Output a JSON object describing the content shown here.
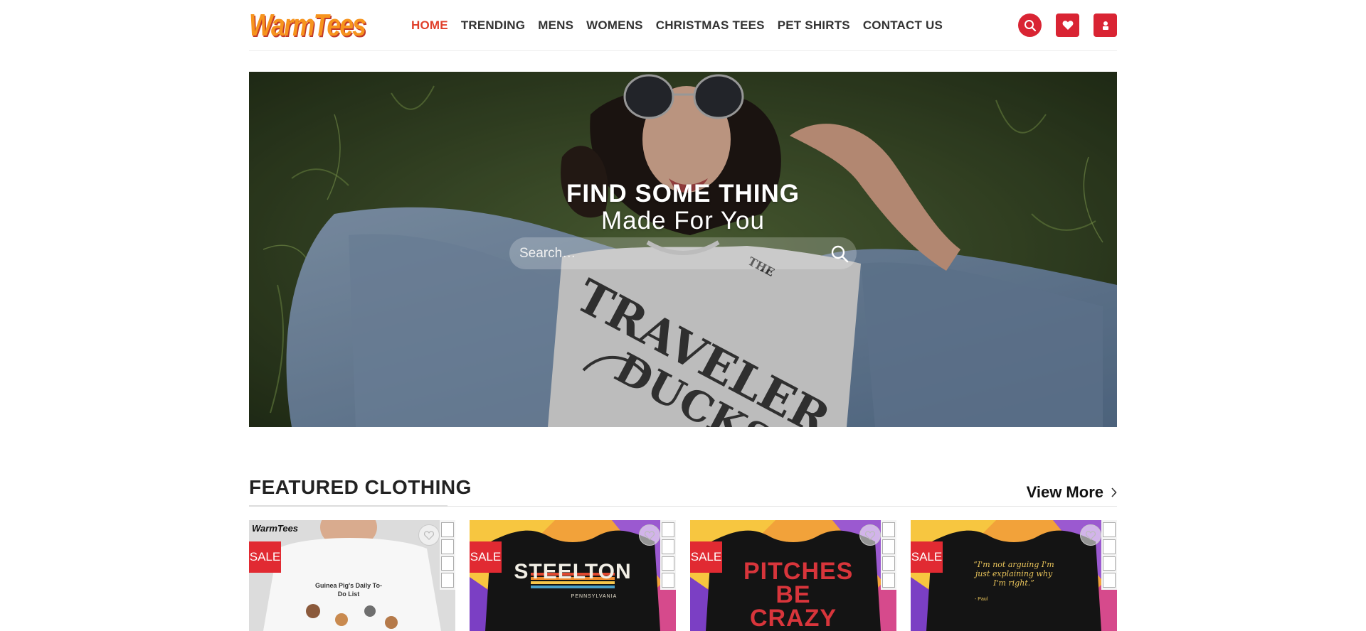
{
  "brand": {
    "logo_text": "WarmTees",
    "accent": "#d92433",
    "active_nav": "#e0402b"
  },
  "nav": {
    "items": [
      "HOME",
      "TRENDING",
      "MENS",
      "WOMENS",
      "CHRISTMAS TEES",
      "PET SHIRTS",
      "CONTACT US"
    ]
  },
  "header_icons": [
    "search-icon",
    "heart-icon",
    "user-icon"
  ],
  "hero": {
    "title": "FIND SOME THING",
    "subtitle": "Made For You",
    "search_placeholder": "Search…"
  },
  "featured": {
    "title": "FEATURED CLOTHING",
    "view_more": "View More",
    "products": [
      {
        "badge": "SALE",
        "shirt_logo": "WarmTees",
        "shirt_text": "Guinea Pig's Daily To-Do List"
      },
      {
        "badge": "SALE",
        "shirt_text": "STEELTON",
        "shirt_subtext": "PENNSYLVANIA"
      },
      {
        "badge": "SALE",
        "shirt_text": "PITCHES BE CRAZY"
      },
      {
        "badge": "SALE",
        "shirt_text": "“I'm not arguing I'm just explaining why I'm right.”",
        "shirt_subtext": "- Paul"
      }
    ]
  }
}
